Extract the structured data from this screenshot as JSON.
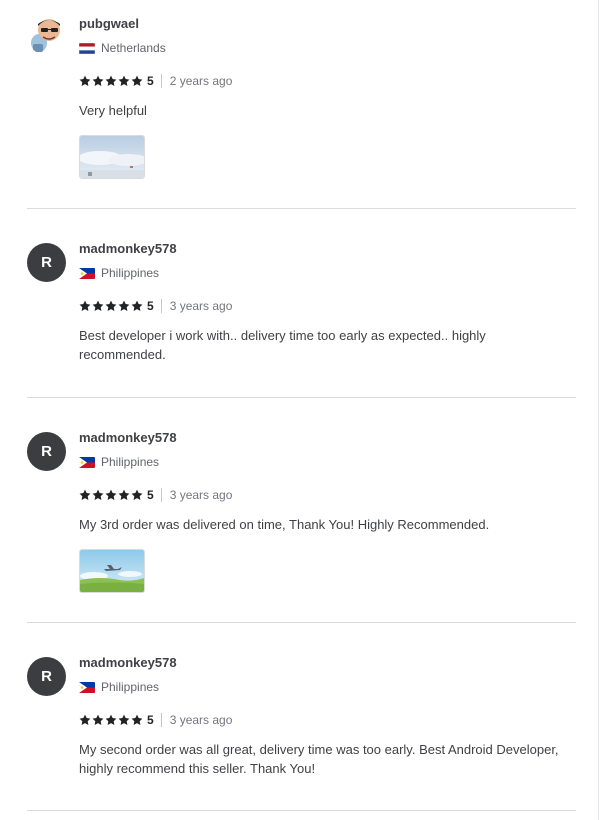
{
  "reviews": [
    {
      "username": "pubgwael",
      "country": "Netherlands",
      "avatar_type": "memoji-image",
      "rating": "5",
      "time": "2 years ago",
      "text": "Very helpful",
      "has_attachment": true,
      "attachment_icon": "cloudy-sky-thumbnail"
    },
    {
      "username": "madmonkey578",
      "country": "Philippines",
      "avatar_letter": "R",
      "rating": "5",
      "time": "3 years ago",
      "text": "Best developer i work with.. delivery time too early as expected.. highly recommended.",
      "has_attachment": false
    },
    {
      "username": "madmonkey578",
      "country": "Philippines",
      "avatar_letter": "R",
      "rating": "5",
      "time": "3 years ago",
      "text": "My 3rd order was delivered on time, Thank You! Highly Recommended.",
      "has_attachment": true,
      "attachment_icon": "green-field-airplane-thumbnail"
    },
    {
      "username": "madmonkey578",
      "country": "Philippines",
      "avatar_letter": "R",
      "rating": "5",
      "time": "3 years ago",
      "text": "My second order was all great, delivery time was too early. Best Android Developer, highly recommend this seller. Thank You!",
      "has_attachment": false
    }
  ],
  "colors": {
    "star": "#222325",
    "avatar_bg": "#3c3d40",
    "divider": "#dadbdd"
  }
}
